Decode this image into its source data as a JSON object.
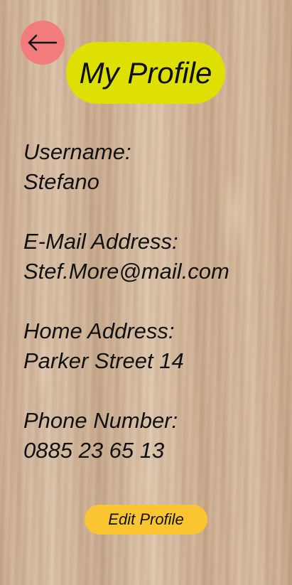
{
  "header": {
    "back_icon": "arrow-left-icon",
    "title": "My Profile"
  },
  "profile": {
    "username_label": "Username:",
    "username_value": "Stefano",
    "email_label": "E-Mail Address:",
    "email_value": "Stef.More@mail.com",
    "address_label": "Home Address:",
    "address_value": "Parker Street 14",
    "phone_label": "Phone Number:",
    "phone_value": "0885 23 65 13"
  },
  "actions": {
    "edit_label": "Edit Profile"
  },
  "colors": {
    "back_button": "#f27c7c",
    "title_pill": "#dde000",
    "edit_button": "#fbc531"
  }
}
